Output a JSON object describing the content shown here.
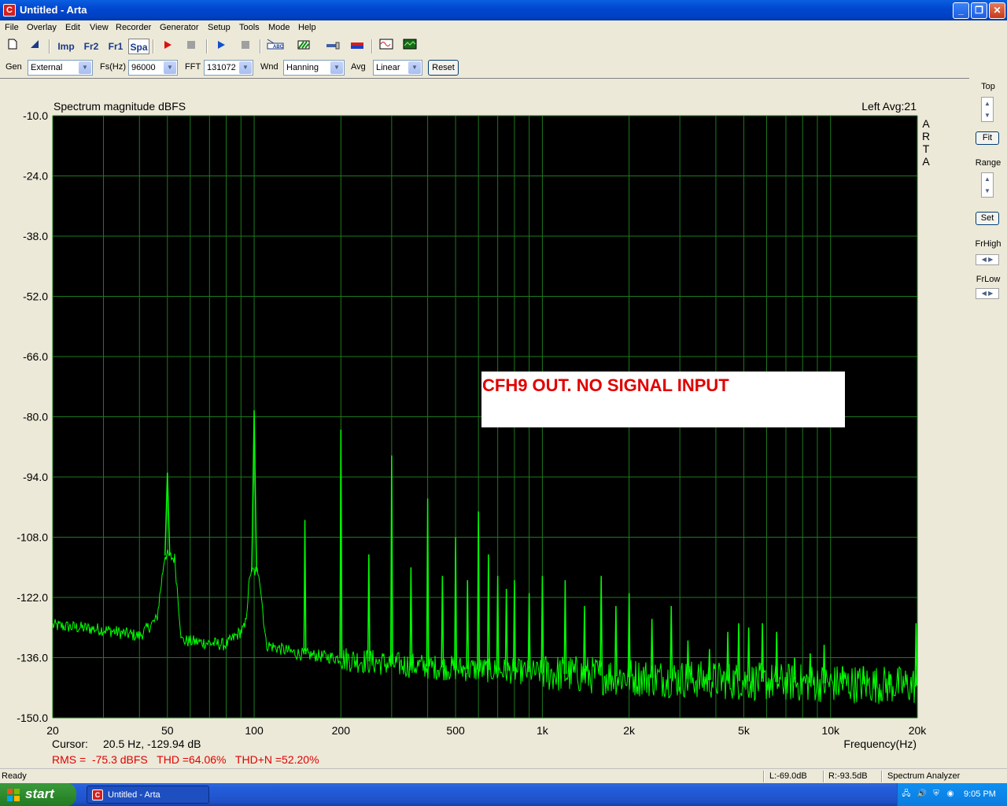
{
  "window": {
    "title": "Untitled - Arta",
    "app_icon": "C"
  },
  "menu": [
    "File",
    "Overlay",
    "Edit",
    "View",
    "Recorder",
    "Generator",
    "Setup",
    "Tools",
    "Mode",
    "Help"
  ],
  "toolbar": {
    "imp": "Imp",
    "fr2": "Fr2",
    "fr1": "Fr1",
    "spa": "Spa"
  },
  "params": {
    "gen_label": "Gen",
    "gen_value": "External",
    "fs_label": "Fs(Hz)",
    "fs_value": "96000",
    "fft_label": "FFT",
    "fft_value": "131072",
    "wnd_label": "Wnd",
    "wnd_value": "Hanning",
    "avg_label": "Avg",
    "avg_value": "Linear",
    "reset_label": "Reset"
  },
  "side": {
    "top_label": "Top",
    "fit_label": "Fit",
    "range_label": "Range",
    "set_label": "Set",
    "frhigh_label": "FrHigh",
    "frlow_label": "FrLow"
  },
  "chart_data": {
    "type": "line",
    "title": "Spectrum magnitude dBFS",
    "channel_info": "Left  Avg:21",
    "side_text": "ARTA",
    "xlabel": "Frequency(Hz)",
    "x_scale": "log",
    "xlim": [
      20,
      20000
    ],
    "ylim": [
      -150,
      -10
    ],
    "grid": true,
    "line_color": "#00FF00",
    "background": "#000000",
    "grid_color": "#1E7A1E",
    "y_ticks": [
      "-10.0",
      "-24.0",
      "-38.0",
      "-52.0",
      "-66.0",
      "-80.0",
      "-94.0",
      "-108.0",
      "-122.0",
      "-136.0",
      "-150.0"
    ],
    "x_ticks": [
      {
        "value": 20,
        "label": "20"
      },
      {
        "value": 50,
        "label": "50"
      },
      {
        "value": 100,
        "label": "100"
      },
      {
        "value": 200,
        "label": "200"
      },
      {
        "value": 500,
        "label": "500"
      },
      {
        "value": 1000,
        "label": "1k"
      },
      {
        "value": 2000,
        "label": "2k"
      },
      {
        "value": 5000,
        "label": "5k"
      },
      {
        "value": 10000,
        "label": "10k"
      },
      {
        "value": 20000,
        "label": "20k"
      }
    ],
    "peaks": [
      {
        "f": 50,
        "db": -93
      },
      {
        "f": 100,
        "db": -78.5
      },
      {
        "f": 150,
        "db": -104
      },
      {
        "f": 200,
        "db": -83
      },
      {
        "f": 250,
        "db": -112
      },
      {
        "f": 300,
        "db": -89
      },
      {
        "f": 350,
        "db": -115
      },
      {
        "f": 400,
        "db": -99
      },
      {
        "f": 450,
        "db": -117
      },
      {
        "f": 500,
        "db": -108
      },
      {
        "f": 550,
        "db": -118
      },
      {
        "f": 600,
        "db": -102
      },
      {
        "f": 650,
        "db": -112
      },
      {
        "f": 700,
        "db": -117
      },
      {
        "f": 750,
        "db": -120
      },
      {
        "f": 800,
        "db": -118
      },
      {
        "f": 900,
        "db": -121
      },
      {
        "f": 1000,
        "db": -117
      },
      {
        "f": 1200,
        "db": -118
      },
      {
        "f": 1400,
        "db": -124
      },
      {
        "f": 1600,
        "db": -117
      },
      {
        "f": 1800,
        "db": -124
      },
      {
        "f": 2000,
        "db": -121
      },
      {
        "f": 2400,
        "db": -127
      },
      {
        "f": 2800,
        "db": -124
      },
      {
        "f": 3200,
        "db": -132
      },
      {
        "f": 3800,
        "db": -134
      },
      {
        "f": 4400,
        "db": -130
      },
      {
        "f": 4800,
        "db": -128
      },
      {
        "f": 5200,
        "db": -129
      },
      {
        "f": 5800,
        "db": -128
      },
      {
        "f": 6500,
        "db": -130
      },
      {
        "f": 7500,
        "db": -136
      },
      {
        "f": 8500,
        "db": -135
      },
      {
        "f": 9500,
        "db": -133
      },
      {
        "f": 11000,
        "db": -138
      },
      {
        "f": 13000,
        "db": -138
      },
      {
        "f": 16000,
        "db": -140
      },
      {
        "f": 19800,
        "db": -128
      }
    ],
    "noise_floor": [
      {
        "f": 20,
        "db": -128.5
      },
      {
        "f": 30,
        "db": -129.5
      },
      {
        "f": 40,
        "db": -131
      },
      {
        "f": 46,
        "db": -127
      },
      {
        "f": 49,
        "db": -112
      },
      {
        "f": 53,
        "db": -113
      },
      {
        "f": 56,
        "db": -132
      },
      {
        "f": 80,
        "db": -133
      },
      {
        "f": 93,
        "db": -129
      },
      {
        "f": 97,
        "db": -116
      },
      {
        "f": 104,
        "db": -116
      },
      {
        "f": 110,
        "db": -133
      },
      {
        "f": 140,
        "db": -135
      },
      {
        "f": 190,
        "db": -136
      },
      {
        "f": 300,
        "db": -137.5
      },
      {
        "f": 500,
        "db": -138.5
      },
      {
        "f": 1000,
        "db": -139.5
      },
      {
        "f": 2000,
        "db": -140.5
      },
      {
        "f": 5000,
        "db": -141.5
      },
      {
        "f": 10000,
        "db": -142
      },
      {
        "f": 20000,
        "db": -142.5
      }
    ],
    "annotation": "CFH9 OUT. NO SIGNAL INPUT",
    "cursor_label": "Cursor:",
    "cursor_value": "20.5 Hz, -129.94 dB",
    "rms_text": "RMS =  -75.3 dBFS   THD =64.06%   THD+N =52.20%"
  },
  "status": {
    "left": "Ready",
    "l_level": "L:-69.0dB",
    "r_level": "R:-93.5dB",
    "mode": "Spectrum Analyzer"
  },
  "taskbar": {
    "start": "start",
    "item": "Untitled - Arta",
    "clock": "9:05 PM"
  }
}
